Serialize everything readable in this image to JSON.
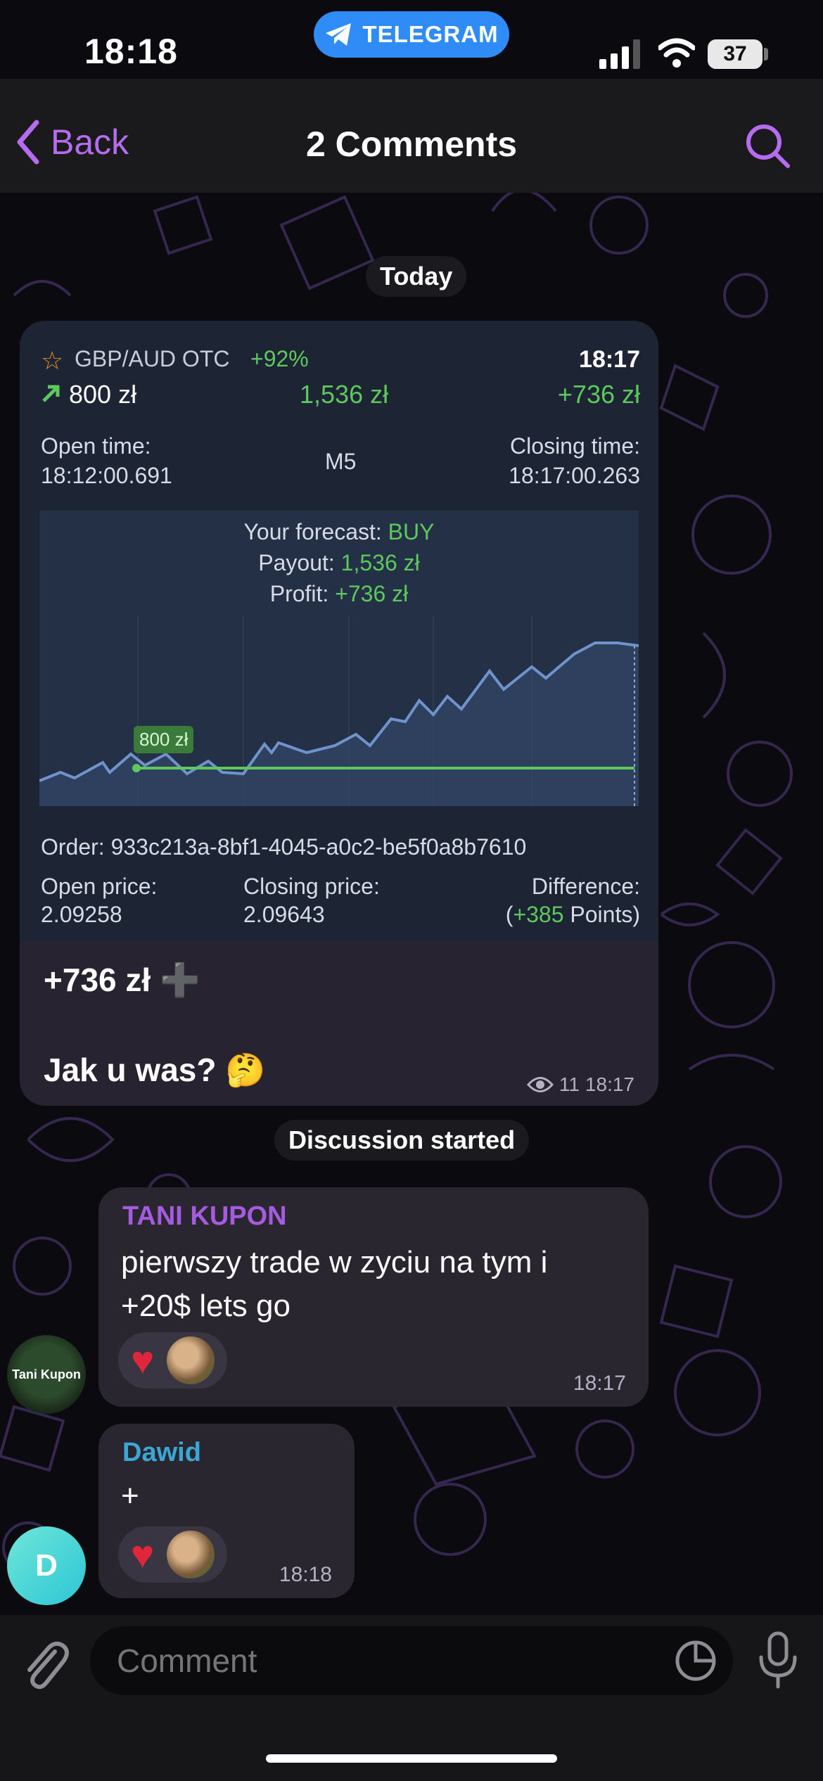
{
  "status_bar": {
    "time": "18:18",
    "app_pill": "TELEGRAM",
    "battery": "37"
  },
  "nav": {
    "back_label": "Back",
    "title": "2 Comments"
  },
  "date_pill": "Today",
  "trade_card": {
    "asset": "GBP/AUD OTC",
    "asset_percent": "+92%",
    "time": "18:17",
    "amount": "800 zł",
    "payout": "1,536 zł",
    "profit": "+736 zł",
    "open_time_label": "Open time:",
    "open_time": "18:12:00.691",
    "timeframe": "M5",
    "closing_time_label": "Closing time:",
    "closing_time": "18:17:00.263",
    "forecast_label": "Your forecast:",
    "forecast_value": "BUY",
    "payout_label": "Payout:",
    "payout_value": "1,536 zł",
    "profit_label": "Profit:",
    "profit_value": "+736 zł",
    "marker_label": "800 zł",
    "order_label": "Order:",
    "order_id": "933c213a-8bf1-4045-a0c2-be5f0a8b7610",
    "open_price_label": "Open price:",
    "open_price": "2.09258",
    "closing_price_label": "Closing price:",
    "closing_price": "2.09643",
    "difference_label": "Difference:",
    "difference_open": "(",
    "difference_value": "+385",
    "difference_unit": "Points)"
  },
  "post": {
    "line1": "+736 zł ➕",
    "line2": "Jak u was? 🤔",
    "views": "11",
    "time": "18:17"
  },
  "discussion_pill": "Discussion started",
  "comments": [
    {
      "author": "TANI KUPON",
      "author_color": "#a45be0",
      "avatar_text": "Tani Kupon",
      "text_line1": "pierwszy trade w zyciu na tym i",
      "text_line2": "+20$ lets go",
      "reaction": "heart",
      "time": "18:17"
    },
    {
      "author": "Dawid",
      "author_color": "#3aa7d6",
      "avatar_text": "D",
      "text": "+",
      "reaction": "heart",
      "time": "18:18"
    }
  ],
  "composer": {
    "placeholder": "Comment"
  },
  "colors": {
    "accent": "#b56cf0",
    "profit_green": "#5dc85d",
    "telegram_blue": "#2f8bf5"
  }
}
